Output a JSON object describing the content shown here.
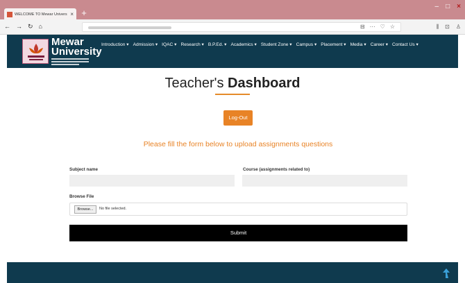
{
  "browser": {
    "tab_title": "WELCOME TO Mewar Univers",
    "tab_close": "×",
    "new_tab": "+",
    "url_icons": [
      "⊟",
      "···",
      "♡",
      "☆"
    ],
    "right_icons": [
      "⫼",
      "⊡",
      "♙"
    ],
    "nav": [
      "←",
      "→",
      "↻",
      "⌂"
    ]
  },
  "site": {
    "brand_line1": "Mewar",
    "brand_line2": "University",
    "menu": [
      "Introduction ▾",
      "Admission ▾",
      "IQAC ▾",
      "Research ▾",
      "B.P.Ed. ▾",
      "Academics ▾",
      "Student Zone ▾",
      "Campus ▾",
      "Placement ▾",
      "Media ▾",
      "Career ▾",
      "Contact Us ▾"
    ]
  },
  "page": {
    "title_light": "Teacher's",
    "title_bold": "Dashboard",
    "logout_label": "Log-Out",
    "instruction": "Please fill the form below to upload assignments questions"
  },
  "form": {
    "subject_label": "Subject name",
    "course_label": "Course (assignments related to)",
    "browse_label": "Browse File",
    "browse_button": "Browse...",
    "no_file": "No file selected.",
    "submit_label": "Submit"
  },
  "colors": {
    "header_bg": "#0f3a4e",
    "accent": "#e88326",
    "tabbar": "#c98a8f"
  }
}
